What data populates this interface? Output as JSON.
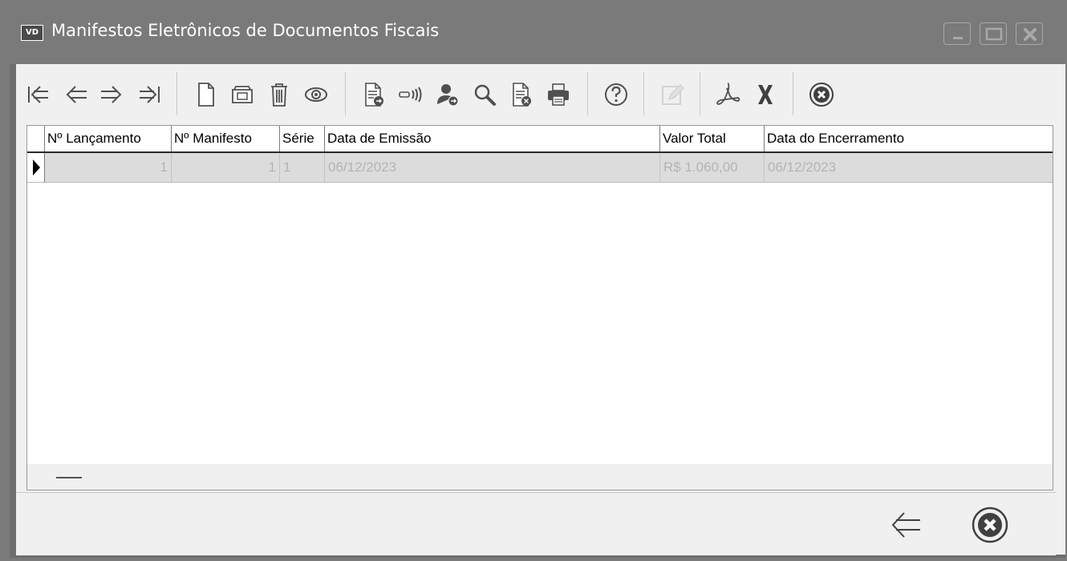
{
  "window": {
    "icon_label": "VD",
    "title": "Manifestos Eletrônicos de Documentos Fiscais",
    "controls": [
      "minimize-icon",
      "maximize-icon",
      "close-icon"
    ]
  },
  "toolbar": {
    "buttons": [
      {
        "name": "first-record-button",
        "icon": "first-icon",
        "enabled": true
      },
      {
        "name": "previous-record-button",
        "icon": "arrow-left-icon",
        "enabled": true
      },
      {
        "name": "next-record-button",
        "icon": "arrow-right-icon",
        "enabled": true
      },
      {
        "name": "last-record-button",
        "icon": "last-icon",
        "enabled": true
      },
      {
        "name": "new-button",
        "icon": "new-document-icon",
        "enabled": true
      },
      {
        "name": "edit-button",
        "icon": "folder-icon",
        "enabled": true
      },
      {
        "name": "delete-button",
        "icon": "trash-icon",
        "enabled": true
      },
      {
        "name": "view-button",
        "icon": "eye-icon",
        "enabled": true
      },
      {
        "name": "transmit-button",
        "icon": "document-send-icon",
        "enabled": true
      },
      {
        "name": "broadcast-button",
        "icon": "signal-icon",
        "enabled": true
      },
      {
        "name": "driver-button",
        "icon": "user-add-icon",
        "enabled": true
      },
      {
        "name": "search-button",
        "icon": "search-icon",
        "enabled": true
      },
      {
        "name": "cancel-document-button",
        "icon": "document-cancel-icon",
        "enabled": true
      },
      {
        "name": "print-button",
        "icon": "printer-icon",
        "enabled": true
      },
      {
        "name": "help-button",
        "icon": "help-icon",
        "enabled": true
      },
      {
        "name": "edit-note-button",
        "icon": "pencil-icon",
        "enabled": false
      },
      {
        "name": "pdf-button",
        "icon": "pdf-icon",
        "enabled": true
      },
      {
        "name": "excel-button",
        "icon": "excel-x-icon",
        "enabled": true
      },
      {
        "name": "close-toolbar-button",
        "icon": "close-circle-icon",
        "enabled": true
      }
    ]
  },
  "grid": {
    "columns": [
      "Nº Lançamento",
      "Nº Manifesto",
      "Série",
      "Data de Emissão",
      "Valor Total",
      "Data do Encerramento"
    ],
    "rows": [
      {
        "lancamento": "1",
        "manifesto": "1",
        "serie": "1",
        "data_emissao": "06/12/2023",
        "valor_total": "R$ 1.060,00",
        "data_encerramento": "06/12/2023"
      }
    ]
  },
  "bottom": {
    "buttons": [
      {
        "name": "back-button",
        "icon": "arrow-left-icon"
      },
      {
        "name": "close-button",
        "icon": "close-circle-icon"
      }
    ]
  }
}
